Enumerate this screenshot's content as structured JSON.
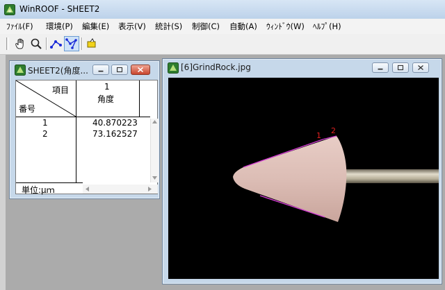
{
  "app": {
    "title": "WinROOF - SHEET2",
    "icon": "winroof-app-icon"
  },
  "menu": [
    {
      "label": "ﾌｧｲﾙ(F)"
    },
    {
      "label": "環境(P)"
    },
    {
      "label": "編集(E)"
    },
    {
      "label": "表示(V)"
    },
    {
      "label": "統計(S)"
    },
    {
      "label": "制御(C)"
    },
    {
      "label": "自動(A)"
    },
    {
      "label": "ｳｨﾝﾄﾞｳ(W)"
    },
    {
      "label": "ﾍﾙﾌﾟ(H)"
    }
  ],
  "toolbar": {
    "buttons": [
      {
        "icon": "hand-icon"
      },
      {
        "icon": "magnifier-icon"
      },
      {
        "icon": "line-measure-icon"
      },
      {
        "icon": "point-measure-icon",
        "pressed": true
      },
      {
        "icon": "pencil-icon"
      }
    ]
  },
  "sheet_window": {
    "title": "SHEET2(角度...",
    "header_item": "項目",
    "header_number": "番号",
    "column_index": "1",
    "column_name": "角度",
    "rows": [
      {
        "num": "1",
        "value": "40.870223"
      },
      {
        "num": "2",
        "value": "73.162527"
      }
    ],
    "unit_label": "単位:μｍ"
  },
  "image_window": {
    "title": "[6]GrindRock.jpg",
    "labels": [
      "1",
      "2"
    ]
  },
  "colors": {
    "measure_line": "#d23cd2",
    "label_red": "#e02020",
    "stone": "#dcbdb5",
    "shaft": "#b8b09a"
  }
}
